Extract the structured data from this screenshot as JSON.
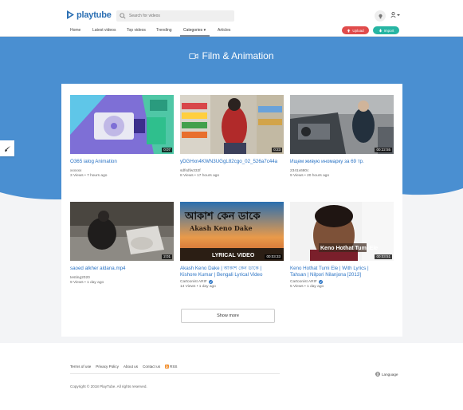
{
  "header": {
    "logo_text": "playtube",
    "search_placeholder": "Search for videos"
  },
  "nav": {
    "items": [
      {
        "label": "Home"
      },
      {
        "label": "Latest videos"
      },
      {
        "label": "Top videos"
      },
      {
        "label": "Trending"
      },
      {
        "label": "Categories ▾"
      },
      {
        "label": "Articles"
      }
    ],
    "upload_label": "Upload",
    "import_label": "Import"
  },
  "hero": {
    "title": "Film & Animation"
  },
  "videos": [
    {
      "title": "O365 ialog Animation",
      "author": "xxxxxx",
      "views": "3 Views",
      "time": "7 hours ago",
      "duration": "0:07",
      "verified": false
    },
    {
      "title": "yDGHxn4KWN3UGgL82cgo_02_526a7c44a",
      "author": "sdfsdfw332f",
      "views": "8 Views",
      "time": "17 hours ago",
      "duration": "0:23",
      "verified": false
    },
    {
      "title": "Ищем живую иномарку за 69 тр.",
      "author": "2341x680c",
      "views": "9 Views",
      "time": "20 hours ago",
      "duration": "00:22:55",
      "verified": false
    },
    {
      "title": "saoed alkher aldana.mp4",
      "author": "testing2020",
      "views": "9 Views",
      "time": "1 day ago",
      "duration": "2:01",
      "verified": false
    },
    {
      "title": "Akash Keno Dake | আকাশ কেন ডাকে | Kishore Kumar | Bengali Lyrical Video",
      "title_line1": "Akash Keno Dake | আকাশ কেন ডাকে |",
      "title_line2": "Kishore Kumar | Bengali Lyrical Video",
      "author": "Cartoonist ARIF",
      "views": "14 Views",
      "time": "1 day ago",
      "duration": "00:03:33",
      "verified": true
    },
    {
      "title": "Keno Hothat Tumi Ele | With Lyrics | Tahsan | Nilpori Nilanjona [2013]",
      "title_line1": "Keno Hothat Tumi Ele | With Lyrics |",
      "title_line2": "Tahsan | Nilpori Nilanjona [2013]",
      "author": "Cartoonist ARIF",
      "views": "5 Views",
      "time": "1 day ago",
      "duration": "00:03:51",
      "verified": true
    }
  ],
  "thumb_text": {
    "v5_big": "আকাশ কেন ডাকে",
    "v5_sub": "Akash Keno Dake",
    "v5_tag": "LYRICAL VIDEO",
    "v6_tag": "Keno Hothat Tumi Ele"
  },
  "show_more_label": "Show more",
  "footer": {
    "links": [
      "Terms of use",
      "Privacy Policy",
      "About us",
      "Contact us",
      "RSS"
    ],
    "copyright": "Copyright © 2018 PlayTube. All rights reserved.",
    "language": "Language"
  },
  "colors": {
    "brand": "#2b6fb3",
    "hero": "#4a8fd1",
    "link": "#2a73c4",
    "upload": "#e04b4b",
    "import": "#26b5a3"
  }
}
